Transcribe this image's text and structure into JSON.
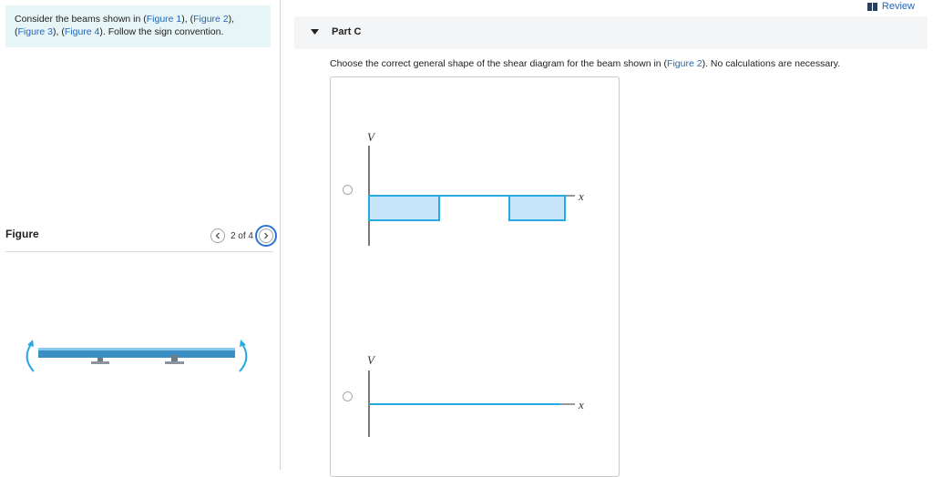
{
  "intro": {
    "part1": "Consider the beams shown in (",
    "fig1": "Figure 1",
    "sep1": "), (",
    "fig2": "Figure 2",
    "sep2": "),",
    "open3": "(",
    "fig3": "Figure 3",
    "sep3": "), (",
    "fig4": "Figure 4",
    "end": "). Follow the sign convention."
  },
  "figure": {
    "title": "Figure",
    "pager_text": "2 of 4",
    "prev_icon": "chevron-left-icon",
    "next_icon": "chevron-right-icon"
  },
  "review": {
    "label": "Review",
    "icon": "book-icon"
  },
  "part": {
    "title": "Part C",
    "toggle_icon": "caret-down-icon"
  },
  "question": {
    "before": "Choose the correct general shape of the shear diagram for the beam shown in (",
    "link": "Figure 2",
    "after": "). No calculations are necessary."
  },
  "choices": [
    {
      "v_label": "V",
      "x_label": "x"
    },
    {
      "v_label": "V",
      "x_label": "x"
    }
  ],
  "colors": {
    "accent": "#2566b4",
    "shear_line": "#29a9e1",
    "shear_fill": "#c8e6fa",
    "intro_bg": "#e8f5f7",
    "beam": "#3a8fc4"
  }
}
